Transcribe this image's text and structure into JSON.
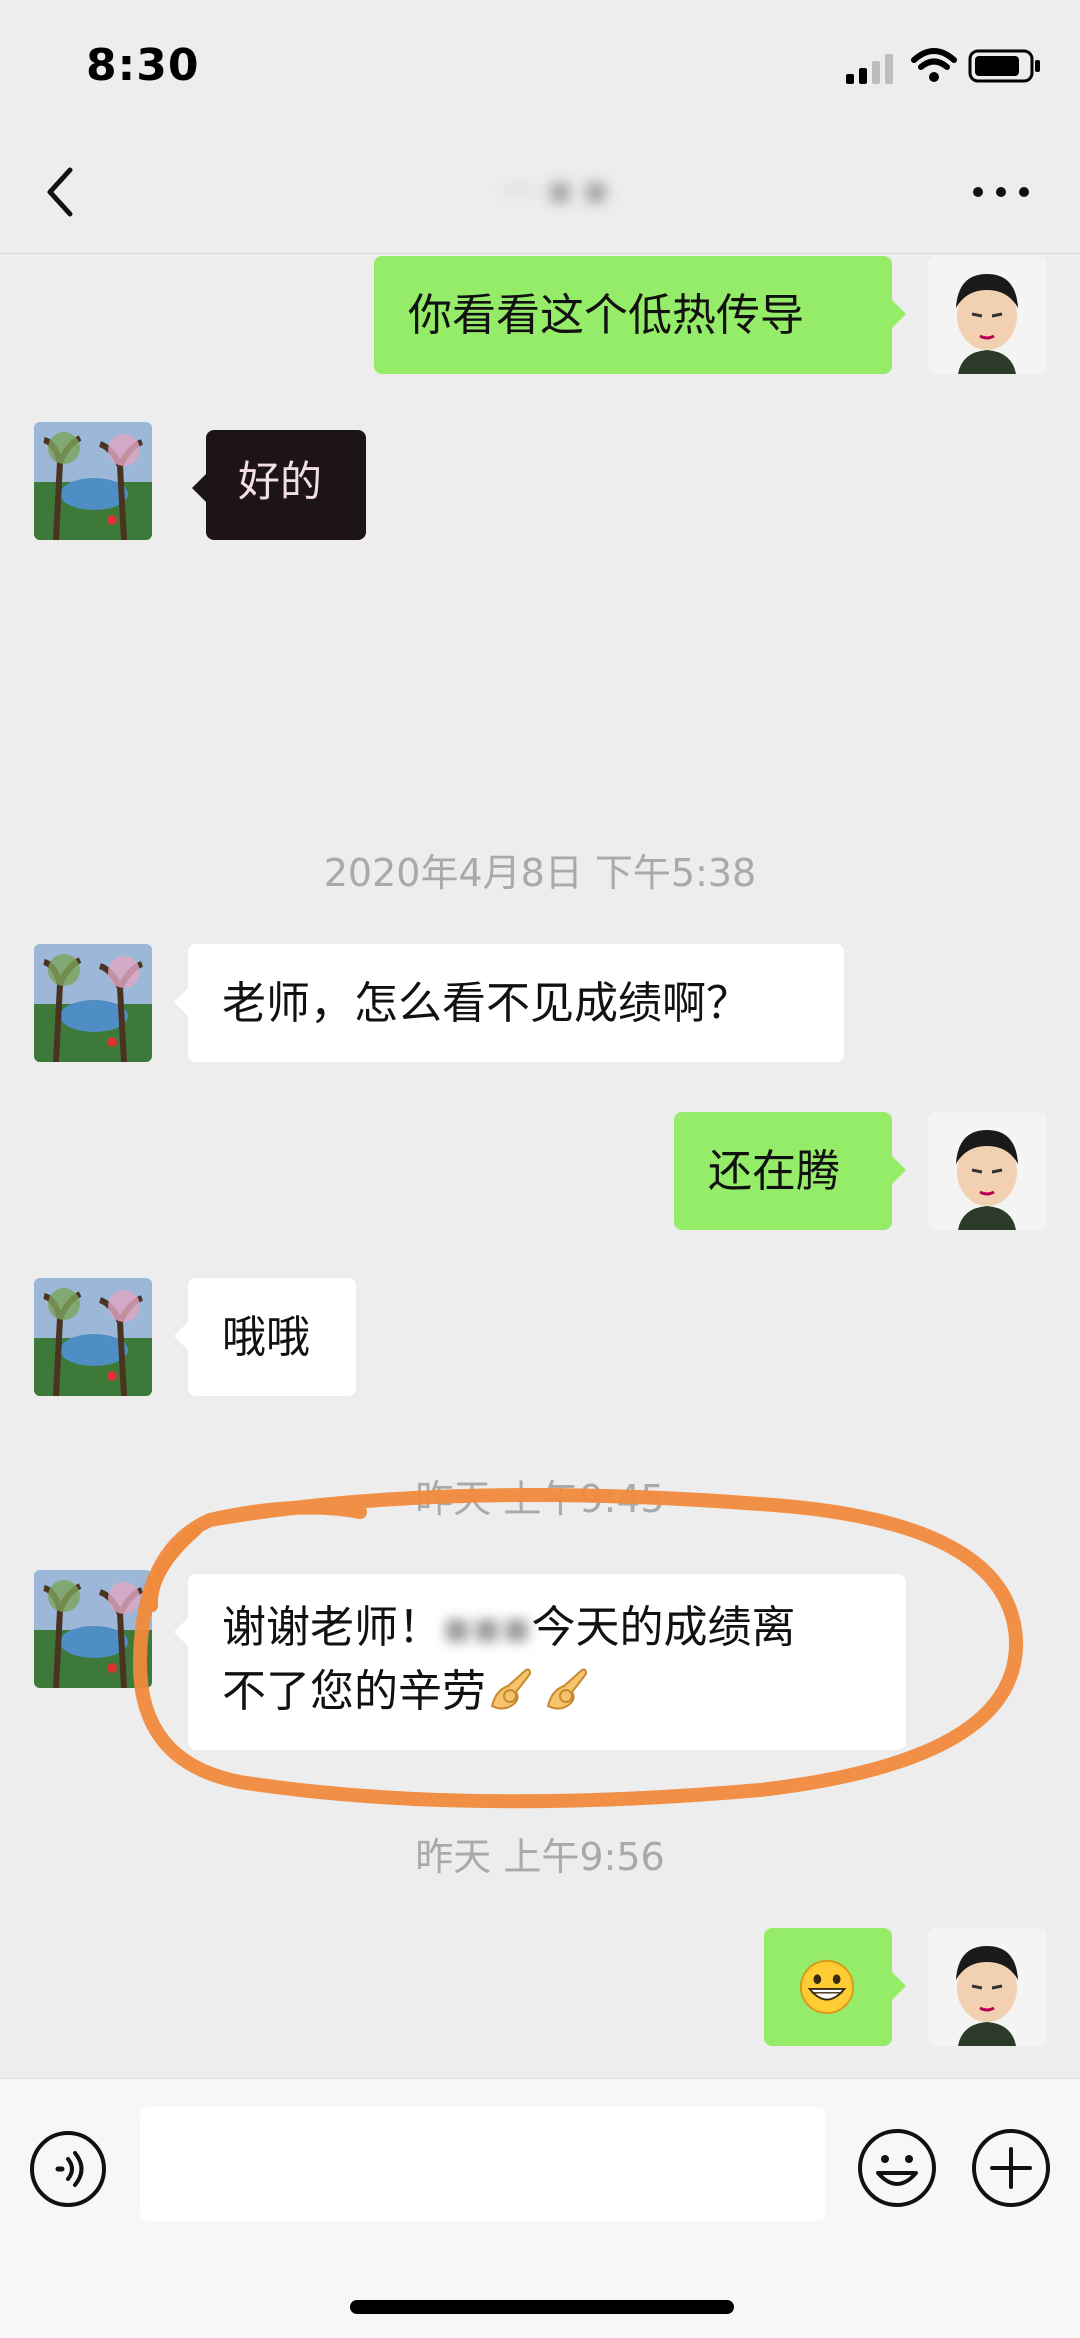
{
  "status_bar": {
    "time": "8:30"
  },
  "nav": {
    "title": "··· ▪ ▪"
  },
  "messages": [
    {
      "side": "out",
      "text": "你看看这个低热传导"
    },
    {
      "side": "in",
      "text": "好的",
      "style": "dark"
    },
    {
      "type": "timestamp",
      "text": "2020年4月8日 下午5:38"
    },
    {
      "side": "in",
      "text": "老师，怎么看不见成绩啊？"
    },
    {
      "side": "out",
      "text": "还在腾"
    },
    {
      "side": "in",
      "text": "哦哦"
    },
    {
      "type": "timestamp",
      "text": "昨天 上午9:45"
    },
    {
      "side": "in",
      "text_line1_start": "谢谢老师！",
      "text_line1_blurred": "▪▪▪",
      "text_line1_end": "今天的成绩离",
      "text_line2": "不了您的辛劳",
      "emoji": [
        "ok-hand-emoji",
        "ok-hand-emoji"
      ]
    },
    {
      "type": "timestamp",
      "text": "昨天 上午9:56"
    },
    {
      "side": "out",
      "emoji": "grinning-face-emoji"
    }
  ],
  "input": {
    "placeholder": ""
  },
  "colors": {
    "outgoing_bubble": "#95ec69",
    "incoming_bubble": "#ffffff",
    "background": "#ededed",
    "annotation": "#f08a3c"
  }
}
